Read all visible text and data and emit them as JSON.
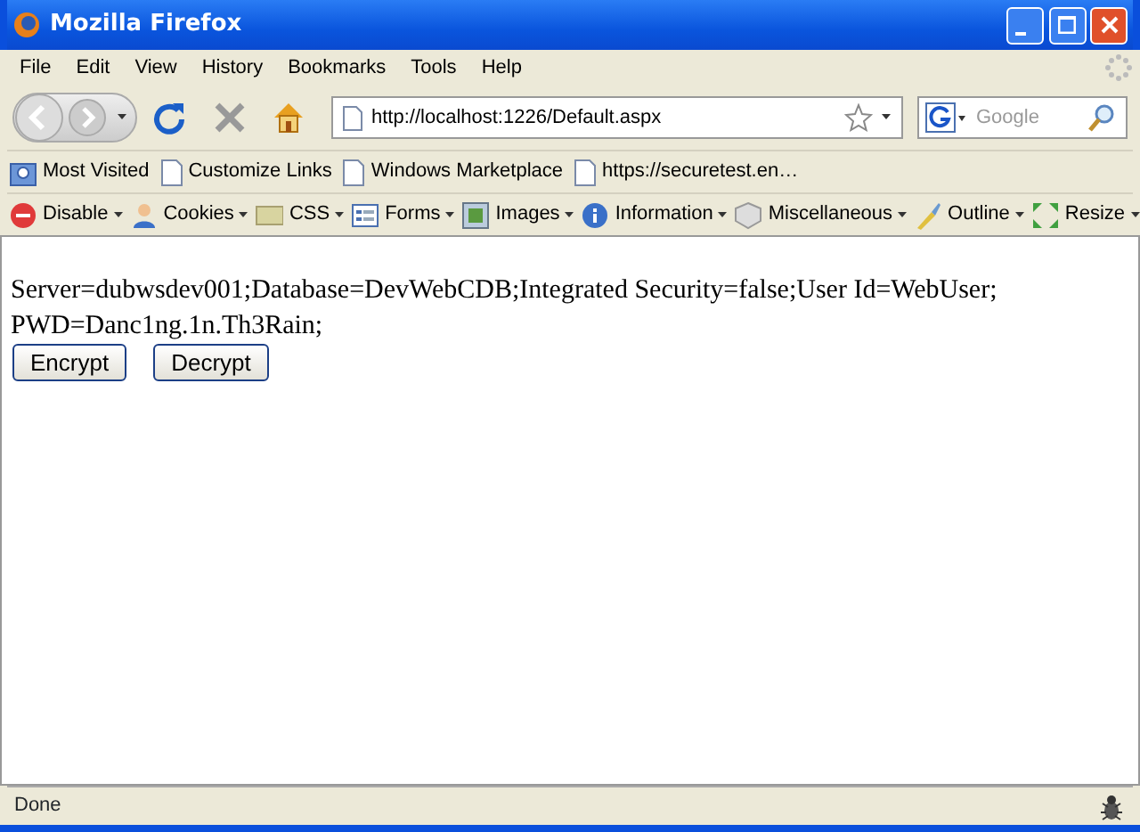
{
  "window": {
    "title": "Mozilla Firefox"
  },
  "menu": [
    "File",
    "Edit",
    "View",
    "History",
    "Bookmarks",
    "Tools",
    "Help"
  ],
  "navigation": {
    "url": "http://localhost:1226/Default.aspx",
    "search_placeholder": "Google"
  },
  "bookmarks": [
    {
      "label": "Most Visited",
      "kind": "folder"
    },
    {
      "label": "Customize Links",
      "kind": "page"
    },
    {
      "label": "Windows Marketplace",
      "kind": "page"
    },
    {
      "label": "https://securetest.en…",
      "kind": "page"
    }
  ],
  "dev_toolbar": [
    {
      "label": "Disable",
      "kind": "disable"
    },
    {
      "label": "Cookies",
      "kind": "cookies"
    },
    {
      "label": "CSS",
      "kind": "css"
    },
    {
      "label": "Forms",
      "kind": "forms"
    },
    {
      "label": "Images",
      "kind": "images"
    },
    {
      "label": "Information",
      "kind": "info"
    },
    {
      "label": "Miscellaneous",
      "kind": "misc"
    },
    {
      "label": "Outline",
      "kind": "outline"
    },
    {
      "label": "Resize",
      "kind": "resize"
    }
  ],
  "content": {
    "text": "Server=dubwsdev001;Database=DevWebCDB;Integrated Security=false;User Id=WebUser; PWD=Danc1ng.1n.Th3Rain;",
    "buttons": [
      "Encrypt",
      "Decrypt"
    ]
  },
  "status_bar": {
    "text": "Done"
  }
}
